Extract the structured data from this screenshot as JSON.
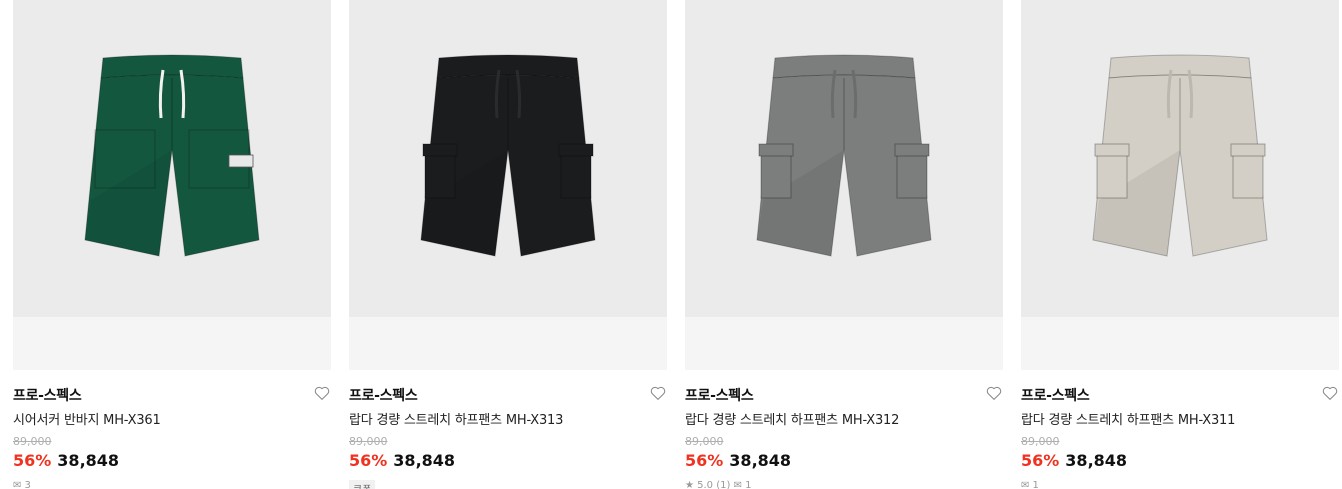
{
  "products": [
    {
      "brand": "프로-스펙스",
      "name": "시어서커 반바지 MH-X361",
      "original_price": "89,000",
      "discount": "56%",
      "price": "38,848",
      "meta": "✉ 3",
      "color": "#14573f",
      "cord": "#f2f2f2",
      "style": "shorts-green"
    },
    {
      "brand": "프로-스펙스",
      "name": "랍다 경량 스트레치 하프팬츠 MH-X313",
      "original_price": "89,000",
      "discount": "56%",
      "price": "38,848",
      "meta": "쿠폰",
      "color": "#1b1c1e",
      "cord": "#2a2b2d",
      "style": "cargo-shorts-black"
    },
    {
      "brand": "프로-스펙스",
      "name": "랍다 경량 스트레치 하프팬츠 MH-X312",
      "original_price": "89,000",
      "discount": "56%",
      "price": "38,848",
      "meta": "★ 5.0 (1)   ✉ 1",
      "color": "#7c7e7e",
      "cord": "#6b6d6d",
      "style": "cargo-shorts-gray"
    },
    {
      "brand": "프로-스펙스",
      "name": "랍다 경량 스트레치 하프팬츠 MH-X311",
      "original_price": "89,000",
      "discount": "56%",
      "price": "38,848",
      "meta": "✉ 1",
      "color": "#d3cfc6",
      "cord": "#bdb8ae",
      "style": "cargo-shorts-beige"
    }
  ]
}
